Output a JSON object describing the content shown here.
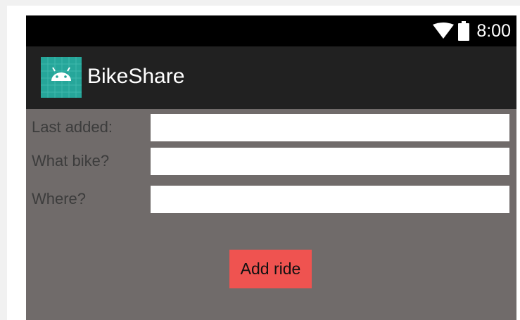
{
  "status_bar": {
    "time": "8:00",
    "icons": [
      "wifi-icon",
      "battery-icon"
    ]
  },
  "app_bar": {
    "title": "BikeShare",
    "icon": "android-icon"
  },
  "form": {
    "rows": [
      {
        "label": "Last added:",
        "value": ""
      },
      {
        "label": "What bike?",
        "value": ""
      },
      {
        "label": "Where?",
        "value": ""
      }
    ],
    "add_button_label": "Add ride"
  },
  "colors": {
    "status_bar": "#000000",
    "app_bar": "#212121",
    "app_icon_bg": "#26a69a",
    "content_bg": "#706b6a",
    "input_bg": "#ffffff",
    "button_bg": "#ef5350"
  }
}
